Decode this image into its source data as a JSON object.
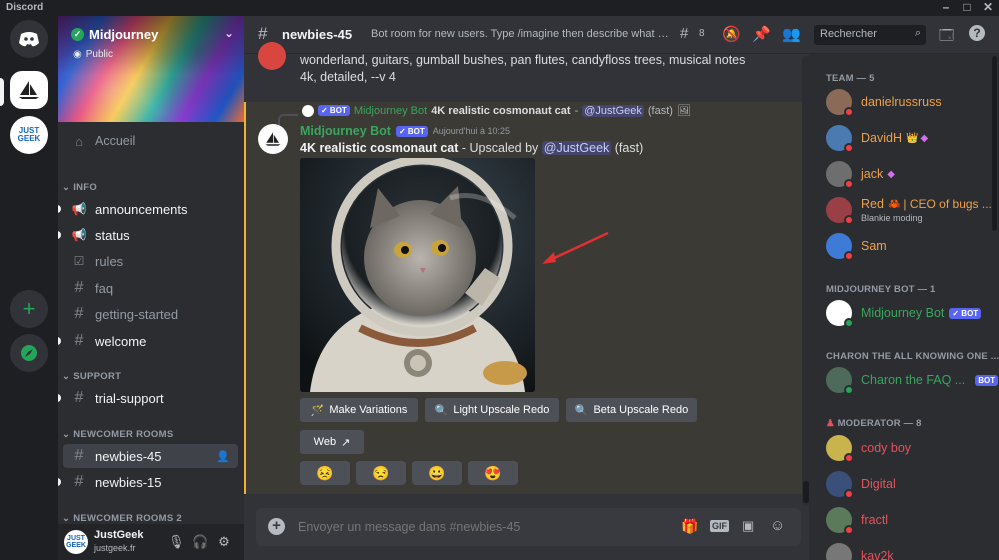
{
  "titlebar": {
    "title": "Discord"
  },
  "server": {
    "name": "Midjourney",
    "visibility": "Public"
  },
  "rail": {
    "server2_label": "JUST GEEK"
  },
  "sidebar": {
    "home": "Accueil",
    "categories": [
      "INFO",
      "SUPPORT",
      "NEWCOMER ROOMS",
      "NEWCOMER ROOMS 2"
    ],
    "channels": [
      "announcements",
      "status",
      "rules",
      "faq",
      "getting-started",
      "welcome",
      "trial-support",
      "newbies-45",
      "newbies-15"
    ]
  },
  "user": {
    "name": "JustGeek",
    "tag": "justgeek.fr"
  },
  "channel_header": {
    "name": "newbies-45",
    "topic": "Bot room for new users. Type /imagine then describe what you...",
    "thread_count": "8",
    "search_placeholder": "Rechercher"
  },
  "messages": {
    "prev_text": "wonderland, guitars, gumball bushes, pan flutes, candyfloss trees, musical notes 4k, detailed, --v 4",
    "reply_author": "Midjourney Bot",
    "reply_text": "4K realistic cosmonaut cat",
    "reply_mention": "@JustGeek",
    "reply_suffix": "(fast)",
    "author": "Midjourney Bot",
    "bot_badge": "BOT",
    "bot_badge_check": "✓ BOT",
    "timestamp": "Aujourd'hui à 10:25",
    "prompt": "4K realistic cosmonaut cat",
    "upscaled_by": " - Upscaled by ",
    "mention": "@JustGeek",
    "speed": "(fast)",
    "buttons": {
      "make_variations": "Make Variations",
      "light_upscale": "Light Upscale Redo",
      "beta_upscale": "Beta Upscale Redo",
      "web": "Web"
    },
    "reactions": [
      "😣",
      "😒",
      "😀",
      "😍"
    ]
  },
  "composer": {
    "placeholder": "Envoyer un message dans #newbies-45"
  },
  "members": {
    "team_label": "TEAM — 5",
    "team": [
      {
        "name": "danielrussruss",
        "color": "#f0a048"
      },
      {
        "name": "DavidH",
        "color": "#f0a048"
      },
      {
        "name": "jack",
        "color": "#f0a048"
      },
      {
        "name": "Red",
        "suffix": "| CEO of bugs ...",
        "sub": "Blankie moding",
        "color": "#f0a048"
      },
      {
        "name": "Sam",
        "color": "#f0a048"
      }
    ],
    "bot_label": "MIDJOURNEY BOT — 1",
    "bot": {
      "name": "Midjourney Bot",
      "badge": "✓ BOT",
      "color": "#3ba55d"
    },
    "charon_label": "CHARON THE ALL KNOWING ONE ...",
    "charon": {
      "name": "Charon the FAQ ...",
      "badge": "BOT",
      "color": "#3ba55d"
    },
    "mod_label": "MODERATOR — 8",
    "mods": [
      {
        "name": "cody boy",
        "color": "#e8515a"
      },
      {
        "name": "Digital",
        "color": "#e8515a"
      },
      {
        "name": "fractl",
        "color": "#e8515a"
      },
      {
        "name": "kav2k",
        "color": "#e8515a"
      }
    ]
  },
  "colors": {
    "accent": "#5865f2",
    "green": "#23a55a",
    "bg": "#313338",
    "sidebar": "#2b2d31"
  }
}
